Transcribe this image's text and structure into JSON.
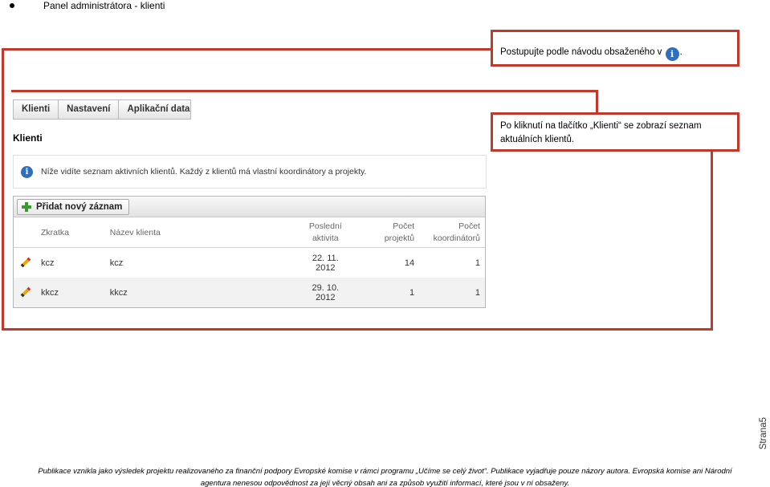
{
  "heading": {
    "title": "Panel administrátora - klienti"
  },
  "callouts": {
    "first": {
      "text_before": "Postupujte podle návodu obsaženého v",
      "text_after": ".",
      "icon": "info-icon"
    },
    "second": {
      "text": "Po kliknutí na tlačítko „Klienti“ se zobrazí seznam aktuálních klientů."
    }
  },
  "app": {
    "tabs": [
      "Klienti",
      "Nastavení",
      "Aplikační data"
    ],
    "section_title": "Klienti",
    "notice": "Níže vidíte seznam aktivních klientů. Každý z klientů má vlastní koordinátory a projekty.",
    "add_button": "Přidat nový záznam",
    "columns": {
      "short": "Zkratka",
      "name": "Název klienta",
      "last_activity_1": "Poslední",
      "last_activity_2": "aktivita",
      "projects_1": "Počet",
      "projects_2": "projektů",
      "coordinators_1": "Počet",
      "coordinators_2": "koordinátorů"
    },
    "rows": [
      {
        "short": "kcz",
        "name": "kcz",
        "date_1": "22. 11.",
        "date_2": "2012",
        "projects": "14",
        "coordinators": "1"
      },
      {
        "short": "kkcz",
        "name": "kkcz",
        "date_1": "29. 10.",
        "date_2": "2012",
        "projects": "1",
        "coordinators": "1"
      }
    ]
  },
  "side_text": "Strana5",
  "footer": {
    "line1": "Publikace vznikla jako výsledek projektu realizovaného za finanční podpory Evropské komise v rámci programu „Učíme se celý život“. Publikace vyjadřuje pouze názory autora. Evropská komise ani Národní",
    "line2": "agentura nenesou odpovědnost za její věcný obsah ani za způsob využití informací, které jsou v ní obsaženy."
  },
  "colors": {
    "annotation": "#c0392b",
    "info": "#2e6fbe"
  }
}
